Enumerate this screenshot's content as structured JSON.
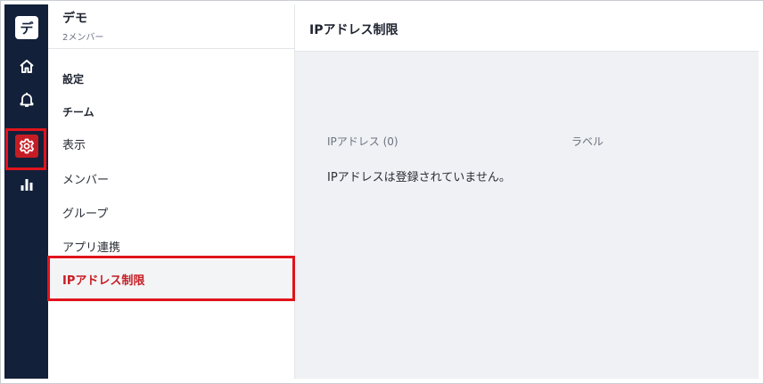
{
  "workspace": {
    "initial": "デ",
    "name": "デモ",
    "members": "2メンバー"
  },
  "rail": [
    {
      "icon": "home-icon"
    },
    {
      "icon": "bell-icon"
    },
    {
      "icon": "gear-icon",
      "active": true
    },
    {
      "icon": "bar-chart-icon"
    }
  ],
  "sidebar": {
    "sections": [
      "設定",
      "チーム"
    ],
    "items": [
      {
        "label": "表示"
      },
      {
        "label": "メンバー"
      },
      {
        "label": "グループ"
      },
      {
        "label": "アプリ連携"
      },
      {
        "label": "IPアドレス制限",
        "active": true
      }
    ]
  },
  "main": {
    "title": "IPアドレス制限",
    "columns": [
      "IPアドレス (0)",
      "ラベル"
    ],
    "empty_message": "IPアドレスは登録されていません。"
  },
  "colors": {
    "rail_bg": "#13203a",
    "accent": "#c61d24",
    "highlight": "#e1141c",
    "content_bg": "#eff1f4"
  }
}
